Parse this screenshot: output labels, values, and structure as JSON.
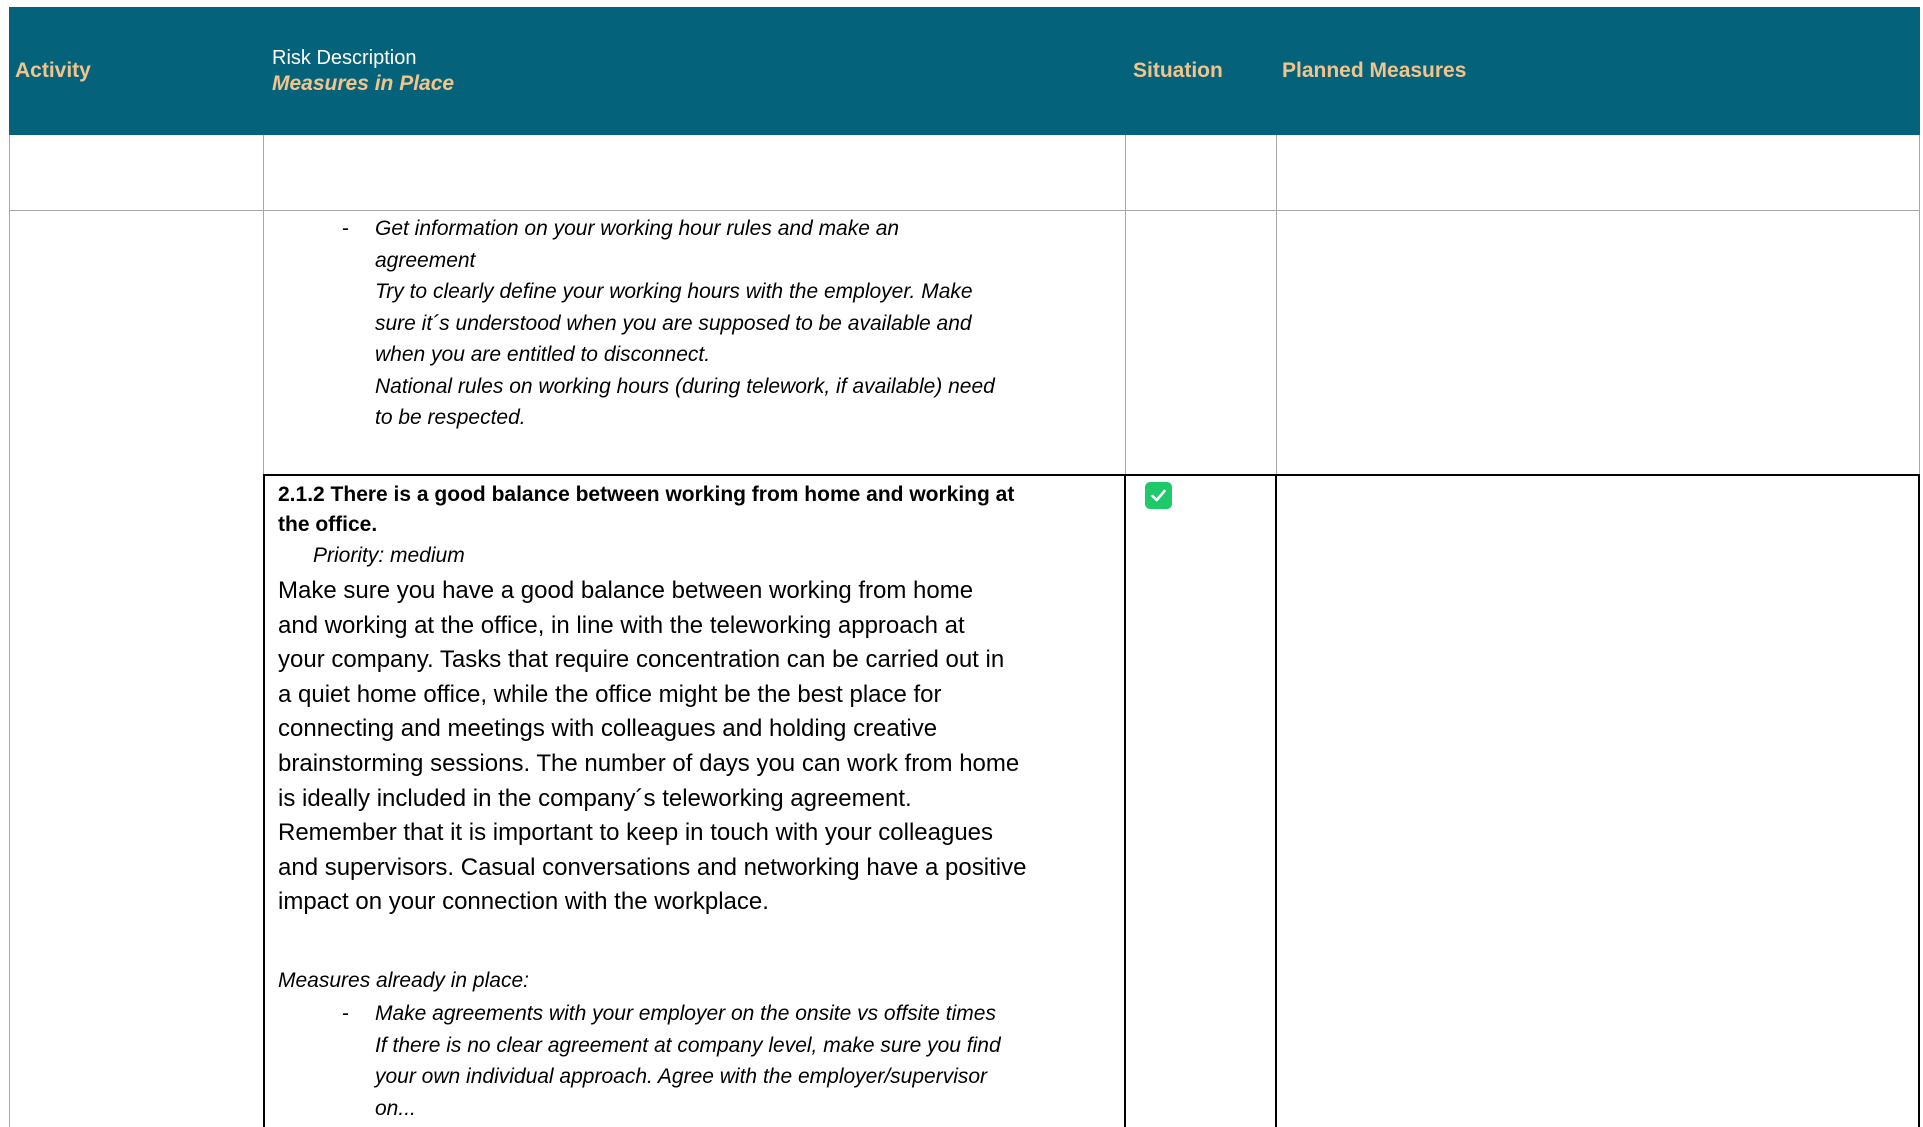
{
  "header": {
    "activity": "Activity",
    "risk_description": "Risk Description",
    "measures_in_place": "Measures in Place",
    "situation": "Situation",
    "planned_measures": "Planned Measures"
  },
  "section1": {
    "measure_title": "Get information on your working hour rules and make an agreement",
    "measure_lines": [
      "Get information on your working hour rules and make an",
      "agreement",
      "Try to clearly define your working hours with the employer. Make",
      "sure it´s understood when you are supposed to be available and",
      "when you are entitled to disconnect.",
      "National rules on working hours (during telework, if available) need",
      "to be respected."
    ]
  },
  "item_2_1_2": {
    "title_lines": [
      "2.1.2 There is a good balance between working from home and working at",
      "the office."
    ],
    "priority": "Priority: medium",
    "description_lines": [
      "Make sure you have a good balance between working from home",
      "and working at the office, in line with the teleworking approach at",
      "your company. Tasks that require concentration can be carried out in",
      "a quiet home office, while the office might be the best place for",
      "connecting and meetings with colleagues and holding creative",
      "brainstorming sessions. The number of days you can work from home",
      "is ideally included in the company´s teleworking agreement.",
      "Remember that it is important to keep in touch with your colleagues",
      "and supervisors. Casual conversations and networking have a positive",
      "impact on your connection with the workplace."
    ],
    "measures_label": "Measures already in place:",
    "measure_lines": [
      "Make agreements with your employer on the onsite vs offsite times",
      "If there is no clear agreement at company level, make sure you find",
      "your own individual approach. Agree with the employer/supervisor",
      "on..."
    ],
    "situation_checked": true,
    "situation_icon": "checkbox-checked-icon",
    "check_color": "#1ec96a"
  },
  "colors": {
    "header_bg": "#04637b",
    "header_accent_text": "#f2c48b",
    "header_plain_text": "#ffffff"
  }
}
